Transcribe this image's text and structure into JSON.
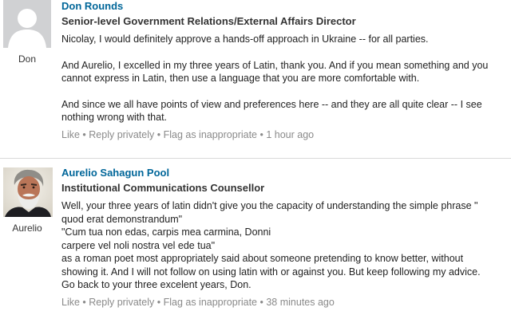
{
  "comments": [
    {
      "author": "Don Rounds",
      "first_name": "Don",
      "headline": "Senior-level Government Relations/External Affairs Director",
      "paragraphs": [
        [
          "Nicolay, I would definitely approve a hands-off approach in Ukraine -- for all parties."
        ],
        [
          "And Aurelio, I excelled in my three years of Latin, thank you. And if you mean something and you",
          "cannot express in Latin, then use a language that you are more comfortable with."
        ],
        [
          "And since we all have points of view and preferences here -- and they are all quite clear -- I see",
          "nothing wrong with that."
        ]
      ],
      "actions": {
        "like": "Like",
        "reply": "Reply privately",
        "flag": "Flag as inappropriate",
        "time": "1 hour ago",
        "separator": " • "
      },
      "avatar_icon": "default-profile-silhouette-icon"
    },
    {
      "author": "Aurelio Sahagun Pool",
      "first_name": "Aurelio",
      "headline": "Institutional Communications Counsellor",
      "paragraphs": [
        [
          "Well, your three years of latin didn't give you the capacity of understanding the simple phrase \"",
          "quod erat demonstrandum\"",
          "\"Cum tua non edas, carpis mea carmina, Donni",
          "carpere vel noli nostra vel ede tua\"",
          "as a roman poet most appropriately said about someone pretending to know better, without",
          "showing it. And I will not follow on using latin with or against you. But keep following my advice.",
          "Go back to your three excelent years, Don."
        ]
      ],
      "actions": {
        "like": "Like",
        "reply": "Reply privately",
        "flag": "Flag as inappropriate",
        "time": "38 minutes ago",
        "separator": " • "
      },
      "avatar_icon": "profile-photo-bearded-man"
    }
  ],
  "colors": {
    "author_link": "#006699",
    "action_text": "#8a8a8a",
    "divider": "#d9d9d9"
  }
}
